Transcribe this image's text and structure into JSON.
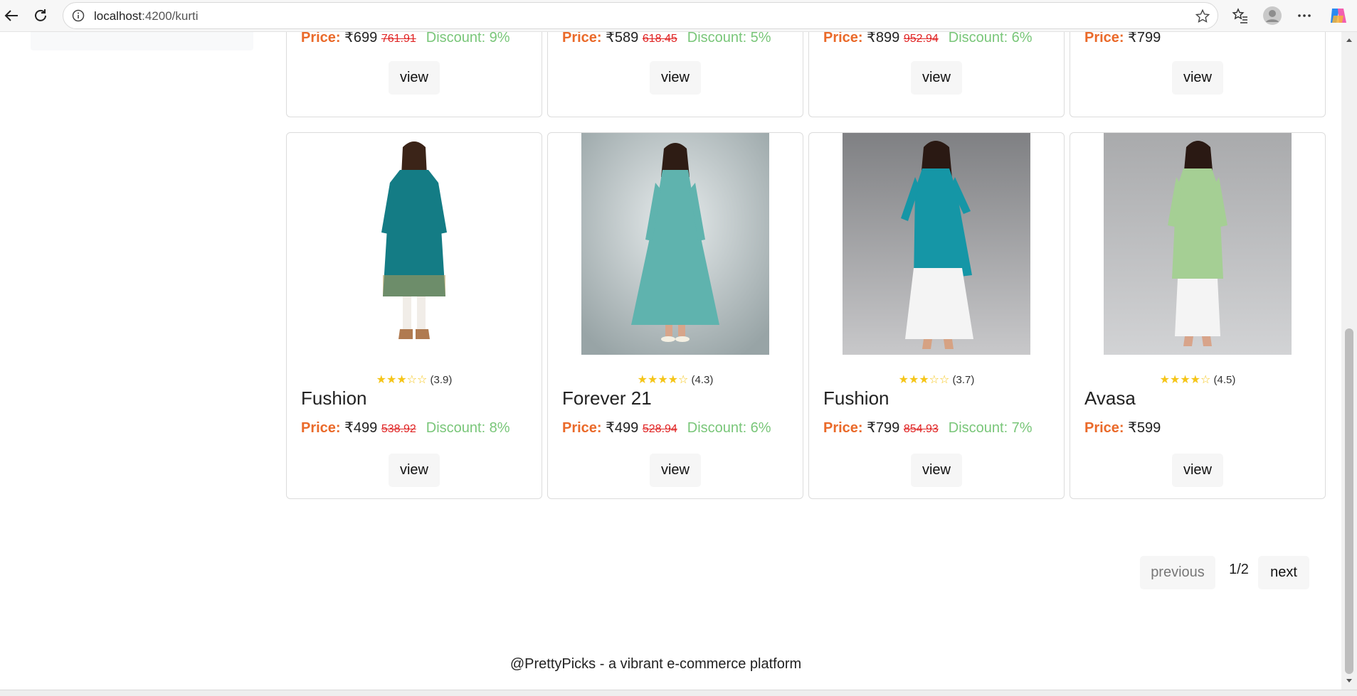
{
  "browser": {
    "url_host": "localhost",
    "url_path": ":4200/kurti"
  },
  "top_row": [
    {
      "price_label": "Price:",
      "price": "₹699",
      "original": "761.91",
      "discount": "Discount: 9%",
      "view": "view"
    },
    {
      "price_label": "Price:",
      "price": "₹589",
      "original": "618.45",
      "discount": "Discount: 5%",
      "view": "view"
    },
    {
      "price_label": "Price:",
      "price": "₹899",
      "original": "952.94",
      "discount": "Discount: 6%",
      "view": "view"
    },
    {
      "price_label": "Price:",
      "price": "₹799",
      "original": "",
      "discount": "",
      "view": "view"
    }
  ],
  "products": [
    {
      "rating": "(3.9)",
      "stars_filled": 3,
      "brand": "Fushion",
      "price_label": "Price:",
      "price": "₹499",
      "original": "538.92",
      "discount": "Discount: 8%",
      "view": "view",
      "colors": {
        "bg": "#ffffff",
        "dress": "#147c85",
        "pants": "#f1ede8"
      }
    },
    {
      "rating": "(4.3)",
      "stars_filled": 4,
      "brand": "Forever 21",
      "price_label": "Price:",
      "price": "₹499",
      "original": "528.94",
      "discount": "Discount: 6%",
      "view": "view",
      "colors": {
        "bg": "#b9c2c4",
        "dress": "#5fb3ae",
        "pants": "#5fb3ae"
      }
    },
    {
      "rating": "(3.7)",
      "stars_filled": 3,
      "brand": "Fushion",
      "price_label": "Price:",
      "price": "₹799",
      "original": "854.93",
      "discount": "Discount: 7%",
      "view": "view",
      "colors": {
        "bg": "#8f9094",
        "dress": "#1596a6",
        "pants": "#f4f4f4"
      }
    },
    {
      "rating": "(4.5)",
      "stars_filled": 4,
      "brand": "Avasa",
      "price_label": "Price:",
      "price": "₹599",
      "original": "",
      "discount": "",
      "view": "view",
      "colors": {
        "bg": "#b6b7b9",
        "dress": "#a5cf94",
        "pants": "#f4f4f4"
      }
    }
  ],
  "pagination": {
    "previous": "previous",
    "page": "1/2",
    "next": "next"
  },
  "footer": {
    "text": "@PrettyPicks - a vibrant e-commerce platform"
  }
}
